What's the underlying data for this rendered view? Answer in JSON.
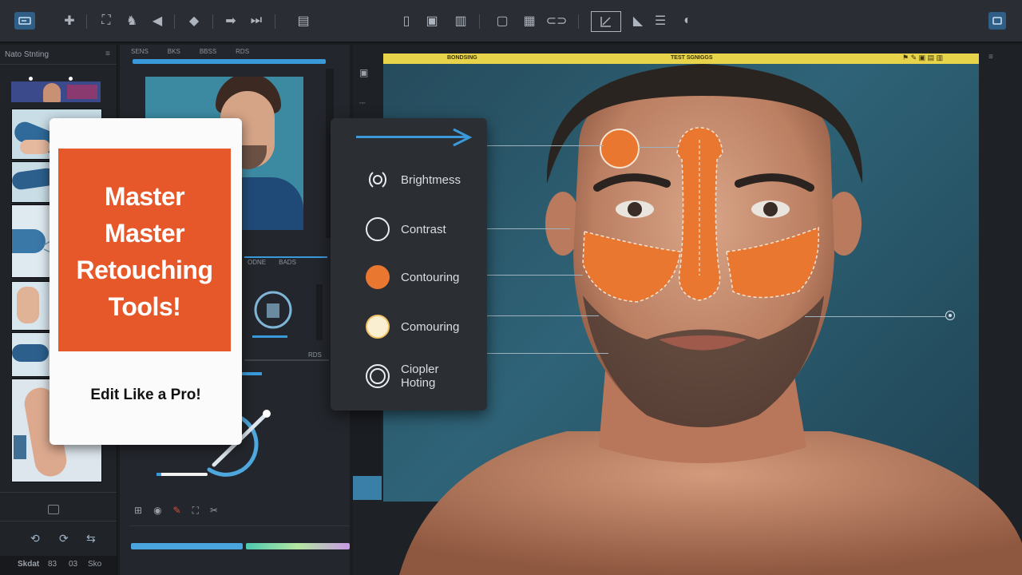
{
  "left_panel": {
    "title": "Nato Stnting"
  },
  "mid_panel": {
    "header_labels": [
      "SENS",
      "BKS",
      "BBSS",
      "RDS"
    ],
    "section_labels": [
      "ODNE",
      "BADS",
      "RDS"
    ]
  },
  "canvas": {
    "header_label": "TEST SGNIGGS",
    "left_label": "BONDSING"
  },
  "promo": {
    "line1": "Master",
    "line2": "Master",
    "line3": "Retouching",
    "line4": "Tools!",
    "cta": "Edit Like a Pro!"
  },
  "tools_menu": {
    "items": [
      {
        "label": "Brightmess",
        "icon": "brightness-icon"
      },
      {
        "label": "Contrast",
        "icon": "contrast-icon"
      },
      {
        "label": "Contouring",
        "icon": "contouring-orange-icon"
      },
      {
        "label": "Comouring",
        "icon": "contouring-cream-icon"
      },
      {
        "label": "Ciopler",
        "label2": "Hoting",
        "icon": "ring-icon"
      }
    ]
  },
  "status_bar": {
    "left_text": "Skdat",
    "items": [
      "83",
      "03",
      "Sko"
    ]
  },
  "colors": {
    "accent_orange": "#e6582a",
    "accent_blue": "#3a9ad9",
    "panel_dark": "#202328",
    "highlight_yellow": "#e7d44a"
  }
}
